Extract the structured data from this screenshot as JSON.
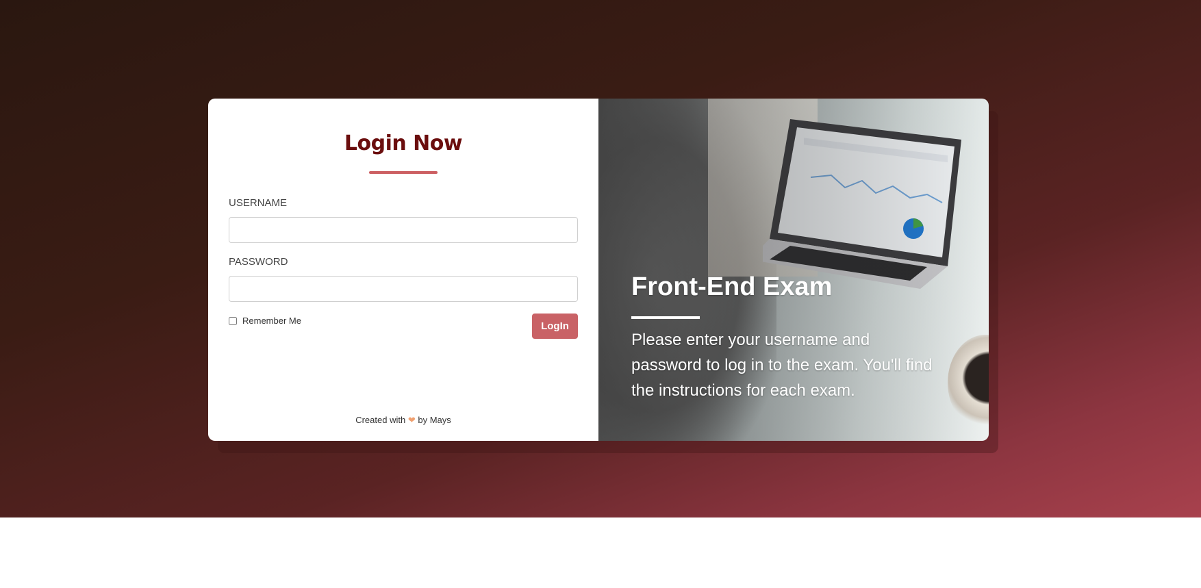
{
  "login": {
    "title": "Login Now",
    "username_label": "USERNAME",
    "username_value": "",
    "password_label": "PASSWORD",
    "password_value": "",
    "remember_label": "Remember Me",
    "remember_checked": false,
    "button_label": "LogIn",
    "footer_prefix": "Created with",
    "footer_suffix": "by Mays"
  },
  "promo": {
    "title": "Front-End Exam",
    "description": "Please enter your username and password to log in to the exam. You'll find the instructions for each exam."
  },
  "icons": {
    "heart": "heart-icon"
  },
  "colors": {
    "title": "#6b0e0e",
    "accent": "#cc5f62",
    "button": "#c96266",
    "heart": "#f0a070"
  }
}
